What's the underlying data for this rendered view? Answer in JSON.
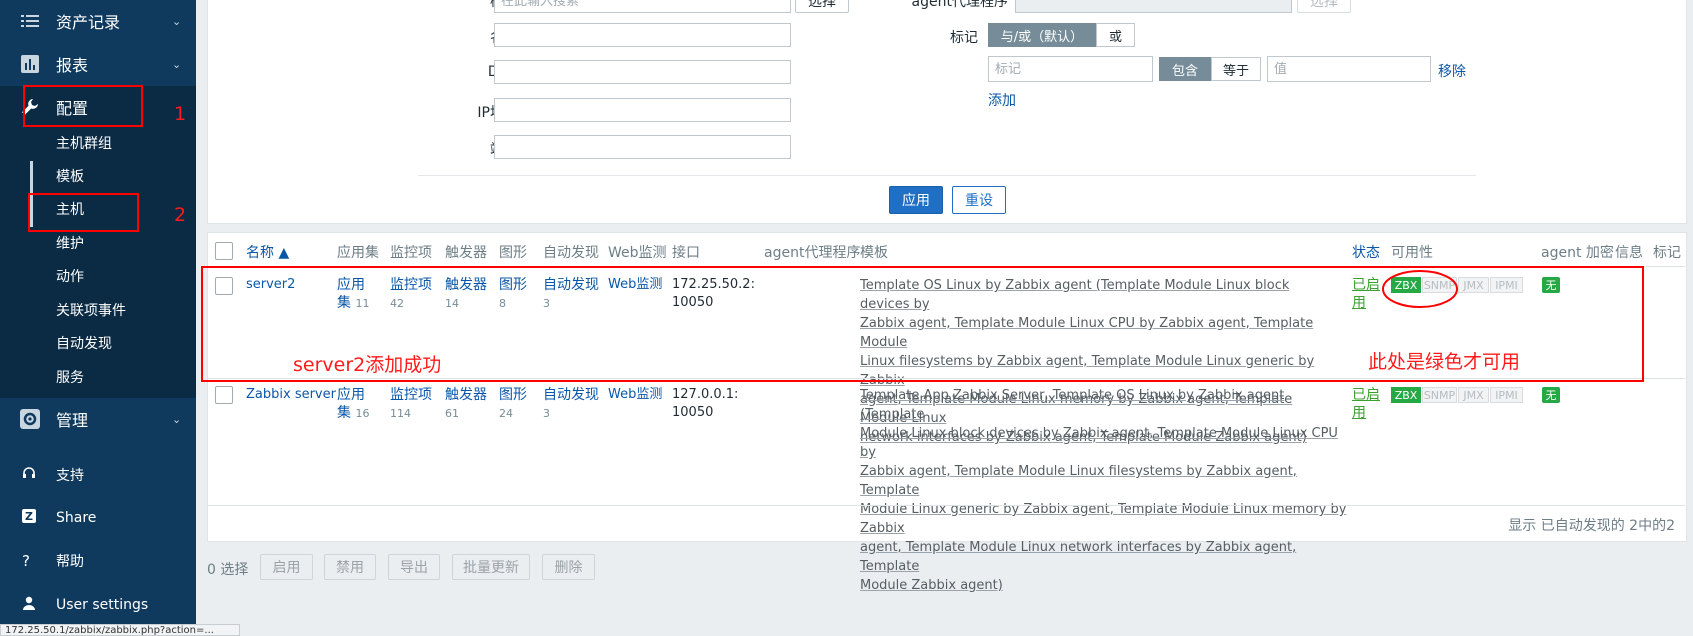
{
  "sidebar": {
    "main_items": [
      {
        "label": "资产记录",
        "icon": "list-icon"
      },
      {
        "label": "报表",
        "icon": "chart-icon"
      },
      {
        "label": "配置",
        "icon": "wrench-icon"
      },
      {
        "label": "管理",
        "icon": "gear-icon"
      }
    ],
    "sub_items": [
      "主机群组",
      "模板",
      "主机",
      "维护",
      "动作",
      "关联项事件",
      "自动发现",
      "服务"
    ],
    "bottom_items": [
      {
        "label": "支持",
        "icon": "headset-icon"
      },
      {
        "label": "Share",
        "icon": "share-icon"
      },
      {
        "label": "帮助",
        "icon": "help-icon"
      },
      {
        "label": "User settings",
        "icon": "user-icon"
      }
    ],
    "chevron": "⌄"
  },
  "filter": {
    "template_label": "模板",
    "template_placeholder": "在此输入搜索",
    "select_label": "选择",
    "proxy_label": "agent代理程序",
    "proxy_select_label": "选择",
    "name_label": "名称",
    "dns_label": "DNS",
    "ip_label": "IP地址",
    "port_label": "端口",
    "tags_label": "标记",
    "andor_label": "与/或（默认）",
    "or_label": "或",
    "tag_placeholder": "标记",
    "contains_label": "包含",
    "equals_label": "等于",
    "value_placeholder": "值",
    "remove_label": "移除",
    "add_label": "添加",
    "apply_label": "应用",
    "reset_label": "重设"
  },
  "table": {
    "headers": {
      "name": "名称 ▲",
      "applications": "应用集",
      "items": "监控项",
      "triggers": "触发器",
      "graphs": "图形",
      "discovery": "自动发现",
      "web": "Web监测",
      "interface": "接口",
      "proxy": "agent代理程序",
      "templates": "模板",
      "status": "状态",
      "availability": "可用性",
      "encryption": "agent 加密",
      "info": "信息",
      "tags": "标记"
    },
    "rows": [
      {
        "name": "server2",
        "app_label": "应用集",
        "app_count": "11",
        "items_label": "监控项",
        "items_count": "42",
        "triggers_label": "触发器",
        "triggers_count": "14",
        "graphs_label": "图形",
        "graphs_count": "8",
        "discovery_label": "自动发现",
        "discovery_count": "3",
        "web": "Web监测",
        "interface_l1": "172.25.50.2:",
        "interface_l2": "10050",
        "templates_lines": [
          "Template OS Linux by Zabbix agent (Template Module Linux block devices by",
          "Zabbix agent, Template Module Linux CPU by Zabbix agent, Template Module",
          "Linux filesystems by Zabbix agent, Template Module Linux generic by Zabbix",
          "agent, Template Module Linux memory by Zabbix agent, Template Module Linux",
          "network interfaces by Zabbix agent, Template Module Zabbix agent)"
        ],
        "status_l1": "已启",
        "status_l2": "用",
        "availability": [
          "ZBX",
          "SNMP",
          "JMX",
          "IPMI"
        ],
        "encryption": "无"
      },
      {
        "name": "Zabbix server",
        "app_label": "应用集",
        "app_count": "16",
        "items_label": "监控项",
        "items_count": "114",
        "triggers_label": "触发器",
        "triggers_count": "61",
        "graphs_label": "图形",
        "graphs_count": "24",
        "discovery_label": "自动发现",
        "discovery_count": "3",
        "web": "Web监测",
        "interface_l1": "127.0.0.1:",
        "interface_l2": "10050",
        "templates_lines": [
          "Template App Zabbix Server, Template OS Linux by Zabbix agent (Template",
          "Module Linux block devices by Zabbix agent, Template Module Linux CPU by",
          "Zabbix agent, Template Module Linux filesystems by Zabbix agent, Template",
          "Module Linux generic by Zabbix agent, Template Module Linux memory by Zabbix",
          "agent, Template Module Linux network interfaces by Zabbix agent, Template",
          "Module Zabbix agent)"
        ],
        "status_l1": "已启",
        "status_l2": "用",
        "availability": [
          "ZBX",
          "SNMP",
          "JMX",
          "IPMI"
        ],
        "encryption": "无"
      }
    ],
    "summary": "显示 已自动发现的 2中的2"
  },
  "footer": {
    "selected": "0 选择",
    "buttons": [
      "启用",
      "禁用",
      "导出",
      "批量更新",
      "删除"
    ]
  },
  "annotations": {
    "step1": "1",
    "step2": "2",
    "added_success": "server2添加成功",
    "green_note": "此处是绿色才可用"
  },
  "statusbar": {
    "url": "172.25.50.1/zabbix/zabbix.php?action=..."
  },
  "colors": {
    "sidebar": "#0f3a5d",
    "accent": "#1f6fc5",
    "available": "#26a844",
    "annotation": "#ff0000"
  }
}
